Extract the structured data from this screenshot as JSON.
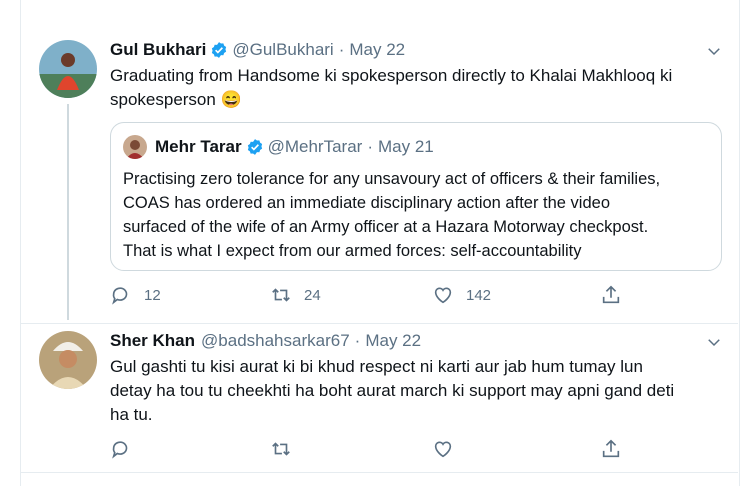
{
  "tweet1": {
    "name": "Gul Bukhari",
    "handle": "@GulBukhari",
    "date": "May 22",
    "text_line1": "Graduating from Handsome ki spokesperson directly to Khalai Makhlooq ki",
    "text_line2": "spokesperson 😄",
    "quote": {
      "name": "Mehr Tarar",
      "handle": "@MehrTarar",
      "date": "May 21",
      "line1": "Practising zero tolerance for any unsavoury act of officers & their families,",
      "line2": "COAS has ordered an immediate disciplinary action after the video",
      "line3": "surfaced of the wife of an Army officer at a Hazara Motorway checkpost.",
      "line4": "That is what I expect from our armed forces: self-accountability"
    },
    "replies": "12",
    "retweets": "24",
    "likes": "142"
  },
  "tweet2": {
    "name": "Sher Khan",
    "handle": "@badshahsarkar67",
    "date": "May 22",
    "text_line1": "Gul gashti tu kisi aurat ki bi khud respect ni karti aur jab hum tumay lun",
    "text_line2": "detay ha tou tu cheekhti ha boht  aurat march ki support may apni gand deti",
    "text_line3": "ha tu."
  },
  "icons": {
    "verified": "verified-badge-icon",
    "reply": "reply-icon",
    "retweet": "retweet-icon",
    "like": "heart-icon",
    "share": "share-icon",
    "more": "chevron-down-icon"
  },
  "colors": {
    "verified": "#1da1f2",
    "muted": "#5b7083",
    "border": "#cfd9de"
  }
}
